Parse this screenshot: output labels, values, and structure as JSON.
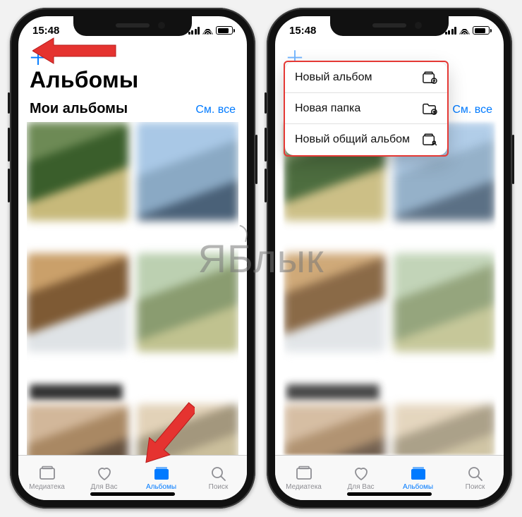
{
  "status": {
    "time": "15:48"
  },
  "header": {
    "large_title": "Альбомы",
    "section_title": "Мои альбомы",
    "see_all": "См. все"
  },
  "tabs": {
    "library": "Медиатека",
    "for_you": "Для Вас",
    "albums": "Альбомы",
    "search": "Поиск"
  },
  "menu": {
    "new_album": "Новый альбом",
    "new_folder": "Новая папка",
    "new_shared_album": "Новый общий альбом"
  },
  "watermark": "ЯБлык"
}
